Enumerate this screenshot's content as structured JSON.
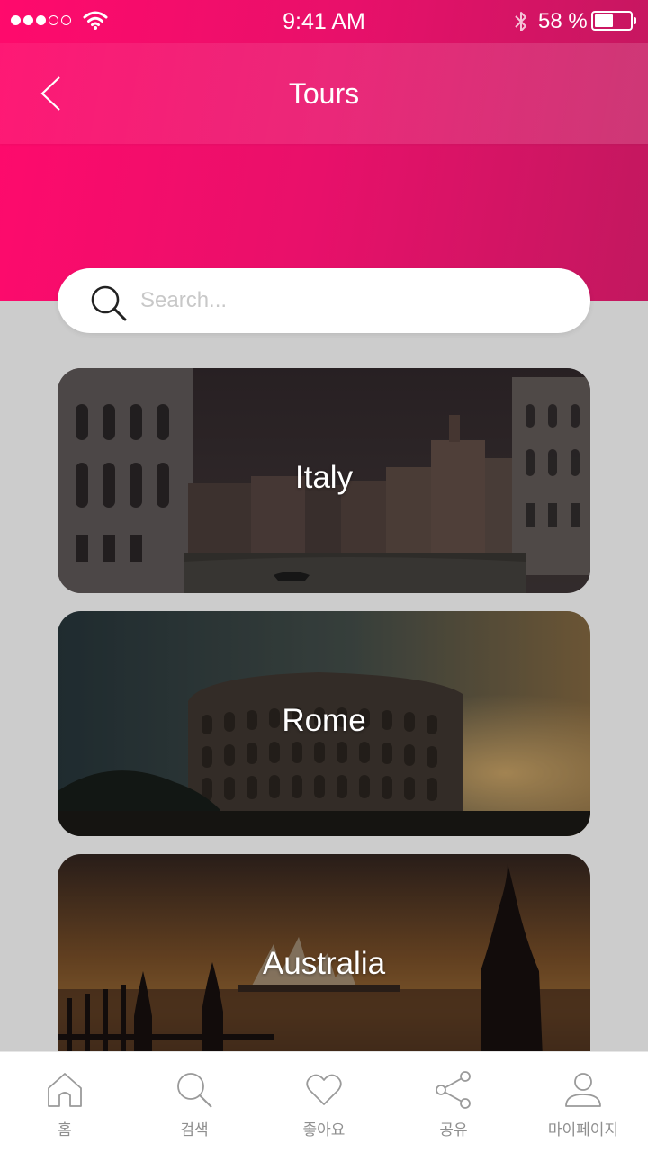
{
  "status_bar": {
    "time": "9:41 AM",
    "battery_percent": "58 %",
    "battery_level": 0.58,
    "signal_bars": 3,
    "signal_total": 5,
    "icons": [
      "signal-dots-icon",
      "wifi-icon",
      "bluetooth-icon",
      "battery-icon"
    ]
  },
  "nav": {
    "title": "Tours",
    "back_icon": "chevron-left-icon"
  },
  "search": {
    "placeholder": "Search...",
    "value": "",
    "icon": "search-icon"
  },
  "tours": [
    {
      "label": "Italy",
      "image": "venice-grand-canal-photo"
    },
    {
      "label": "Rome",
      "image": "colosseum-sunset-photo"
    },
    {
      "label": "Australia",
      "image": "sydney-opera-house-sunset-photo"
    }
  ],
  "tab_bar": {
    "items": [
      {
        "label": "홈",
        "icon": "home-icon"
      },
      {
        "label": "검색",
        "icon": "search-icon"
      },
      {
        "label": "좋아요",
        "icon": "heart-icon"
      },
      {
        "label": "공유",
        "icon": "share-icon"
      },
      {
        "label": "마이페이지",
        "icon": "user-icon"
      }
    ]
  },
  "colors": {
    "brand_gradient_start": "#ff0a6c",
    "brand_gradient_end": "#c2185f",
    "page_background": "#cccccc",
    "tab_label": "#8f8f8f"
  }
}
